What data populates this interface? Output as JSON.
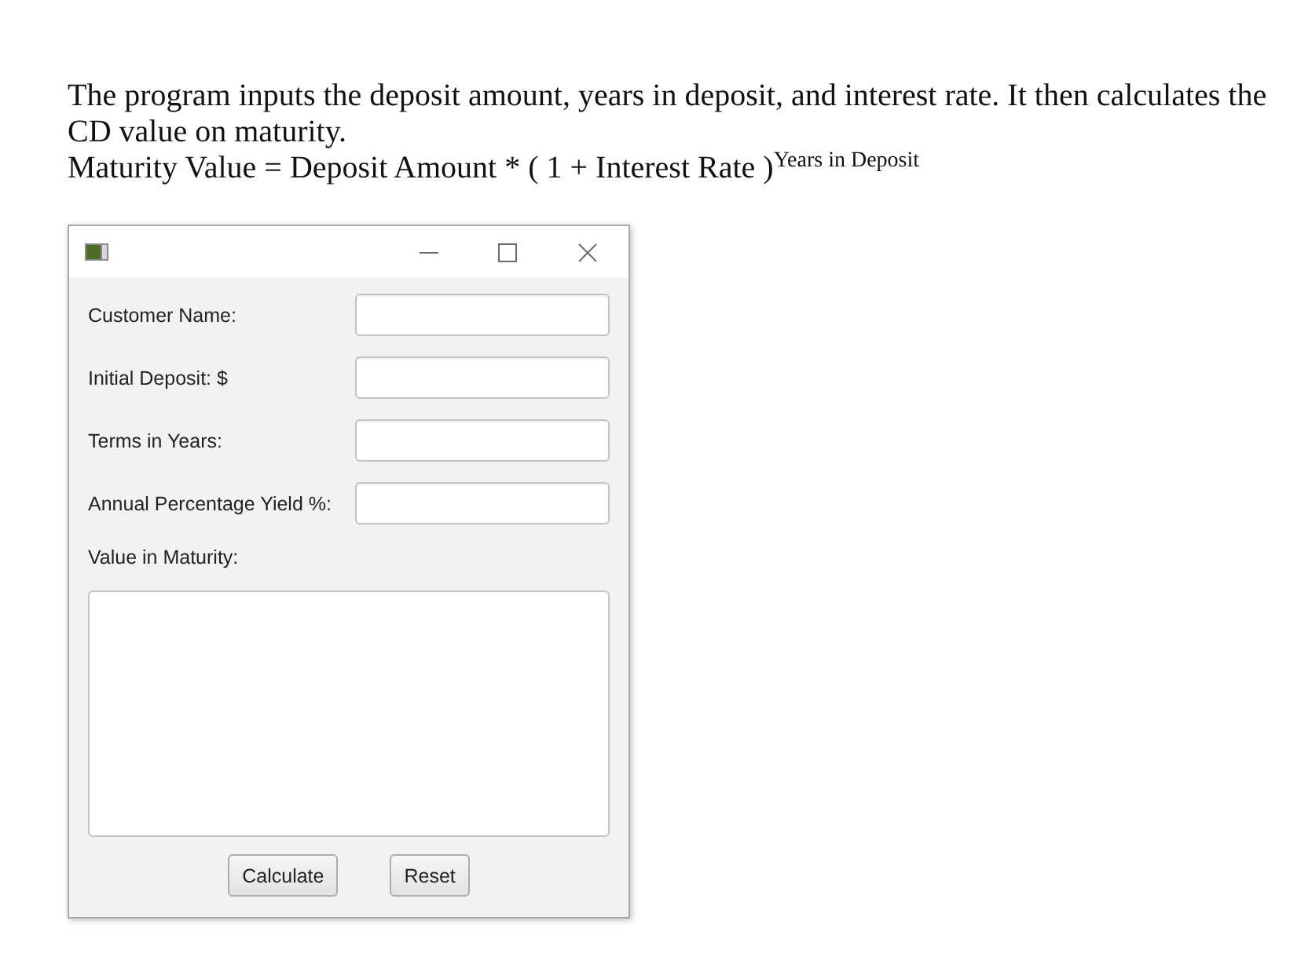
{
  "description": "The program inputs the deposit amount, years in deposit, and interest rate. It then calculates the CD value on maturity.",
  "formula": "Maturity Value = Deposit Amount * ( 1 + Interest Rate )$^{Years in Deposit}$",
  "form": {
    "fields": [
      {
        "label": "Customer Name:"
      },
      {
        "label": "Initial Deposit: $"
      },
      {
        "label": "Terms in Years:"
      },
      {
        "label": "Annual Percentage Yield %:"
      }
    ],
    "output_label": "Value in Maturity:"
  },
  "buttons": [
    {
      "label": "Calculate"
    },
    {
      "label": "Reset"
    }
  ]
}
